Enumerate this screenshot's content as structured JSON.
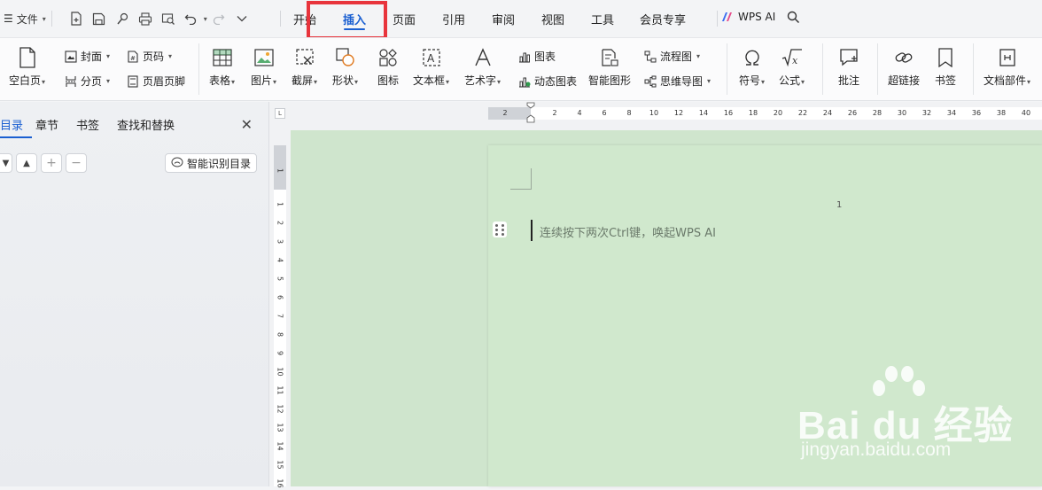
{
  "menubar": {
    "file_menu": "文件",
    "tabs": [
      "开始",
      "插入",
      "页面",
      "引用",
      "审阅",
      "视图",
      "工具",
      "会员专享"
    ],
    "active_tab": "插入",
    "wps_ai": "WPS AI"
  },
  "ribbon": {
    "blank_page": "空白页",
    "cover": "封面",
    "page_break": "分页",
    "page_number": "页码",
    "header_footer": "页眉页脚",
    "table": "表格",
    "picture": "图片",
    "screenshot": "截屏",
    "shape": "形状",
    "icon": "图标",
    "textbox": "文本框",
    "wordart": "艺术字",
    "chart": "图表",
    "dynamic_chart": "动态图表",
    "smart_graphic": "智能图形",
    "flowchart": "流程图",
    "mindmap": "思维导图",
    "symbol": "符号",
    "formula": "公式",
    "comment": "批注",
    "hyperlink": "超链接",
    "bookmark": "书签",
    "doc_parts": "文档部件"
  },
  "navpane": {
    "tabs": [
      "目录",
      "章节",
      "书签",
      "查找和替换"
    ],
    "active_tab": "目录",
    "smart_toc": "智能识别目录"
  },
  "hruler": {
    "labels": [
      "2",
      "2",
      "4",
      "6",
      "8",
      "10",
      "12",
      "14",
      "16",
      "18",
      "20",
      "22",
      "24",
      "26",
      "28",
      "30",
      "32",
      "34",
      "36",
      "38",
      "40"
    ]
  },
  "vruler": {
    "labels": [
      "1",
      "1",
      "2",
      "3",
      "4",
      "5",
      "6",
      "7",
      "8",
      "9",
      "10",
      "11",
      "12",
      "13",
      "14",
      "15",
      "16"
    ]
  },
  "document": {
    "page_number": "1",
    "placeholder": "连续按下两次Ctrl键，唤起WPS AI"
  },
  "watermark": {
    "brand": "Bai du 经验",
    "url": "jingyan.baidu.com"
  },
  "colors": {
    "accent": "#1a5fd1",
    "highlight_box": "#e8343c",
    "page_bg": "#d0e8cd"
  }
}
